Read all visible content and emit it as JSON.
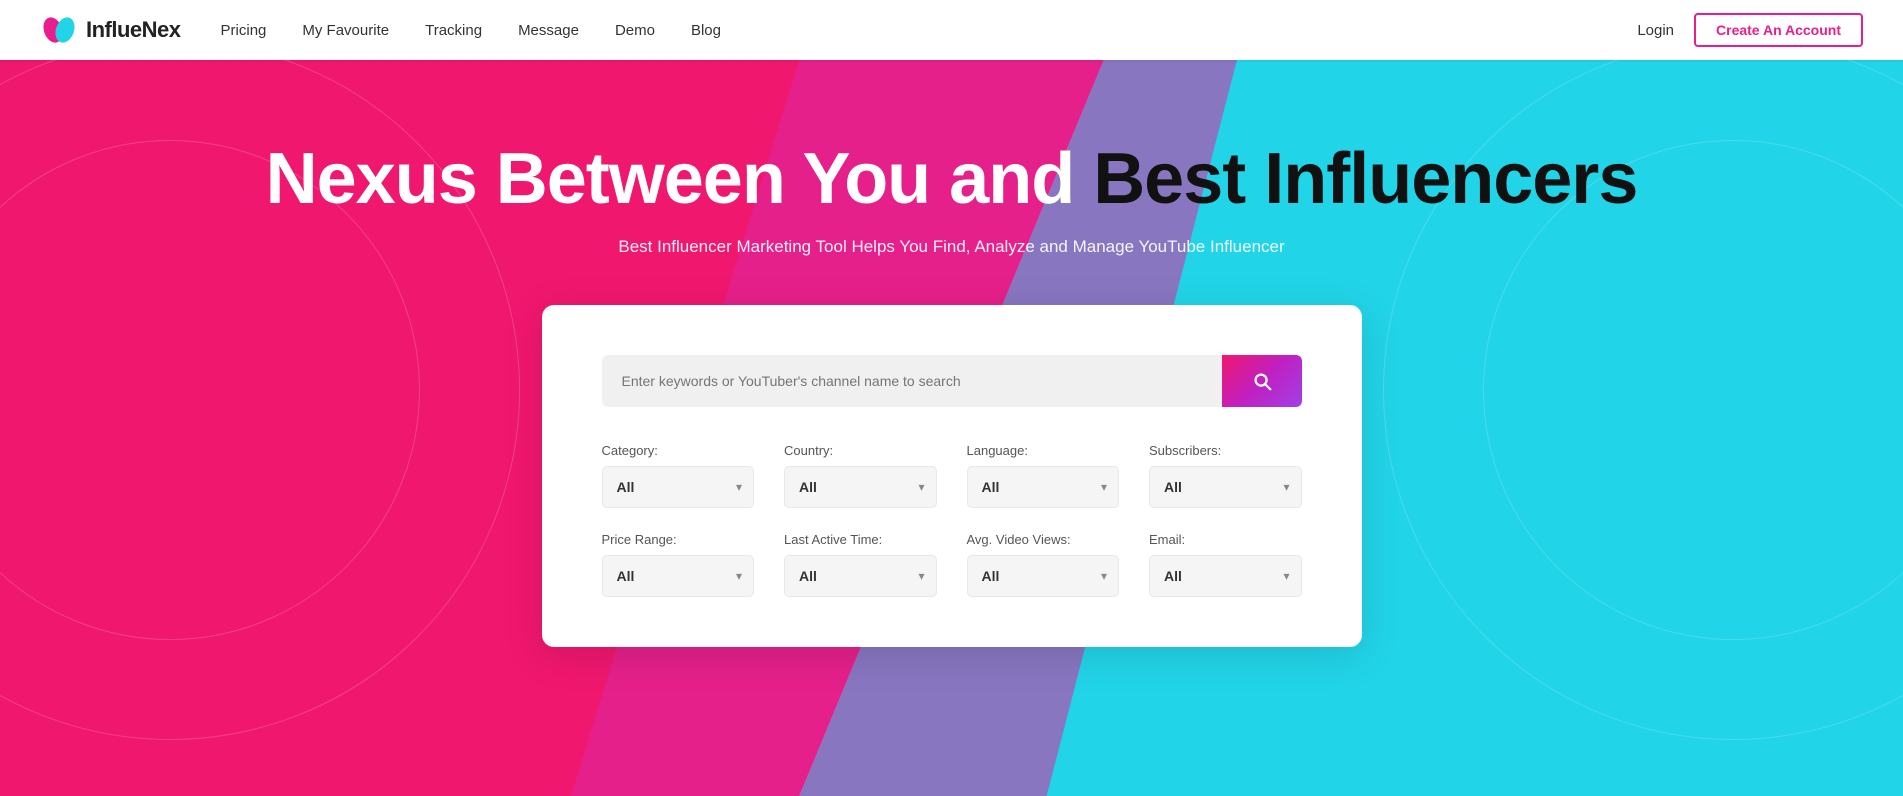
{
  "navbar": {
    "logo_text": "InflueNex",
    "links": [
      {
        "label": "Pricing",
        "id": "pricing"
      },
      {
        "label": "My Favourite",
        "id": "my-favourite"
      },
      {
        "label": "Tracking",
        "id": "tracking"
      },
      {
        "label": "Message",
        "id": "message"
      },
      {
        "label": "Demo",
        "id": "demo"
      },
      {
        "label": "Blog",
        "id": "blog"
      }
    ],
    "login_label": "Login",
    "create_account_label": "Create An Account"
  },
  "hero": {
    "title_part1": "Nexus Between You and ",
    "title_part2": "Best Influencers",
    "subtitle": "Best Influencer Marketing Tool Helps You Find, Analyze and Manage YouTube Influencer"
  },
  "search": {
    "placeholder": "Enter keywords or YouTuber's channel name to search"
  },
  "filters": {
    "category": {
      "label": "Category:",
      "default": "All"
    },
    "country": {
      "label": "Country:",
      "default": "All"
    },
    "language": {
      "label": "Language:",
      "default": "All"
    },
    "subscribers": {
      "label": "Subscribers:",
      "default": "All"
    },
    "price_range": {
      "label": "Price Range:",
      "default": "All"
    },
    "last_active_time": {
      "label": "Last Active Time:",
      "default": "All"
    },
    "avg_video_views": {
      "label": "Avg. Video Views:",
      "default": "All"
    },
    "email": {
      "label": "Email:",
      "default": "All"
    }
  }
}
